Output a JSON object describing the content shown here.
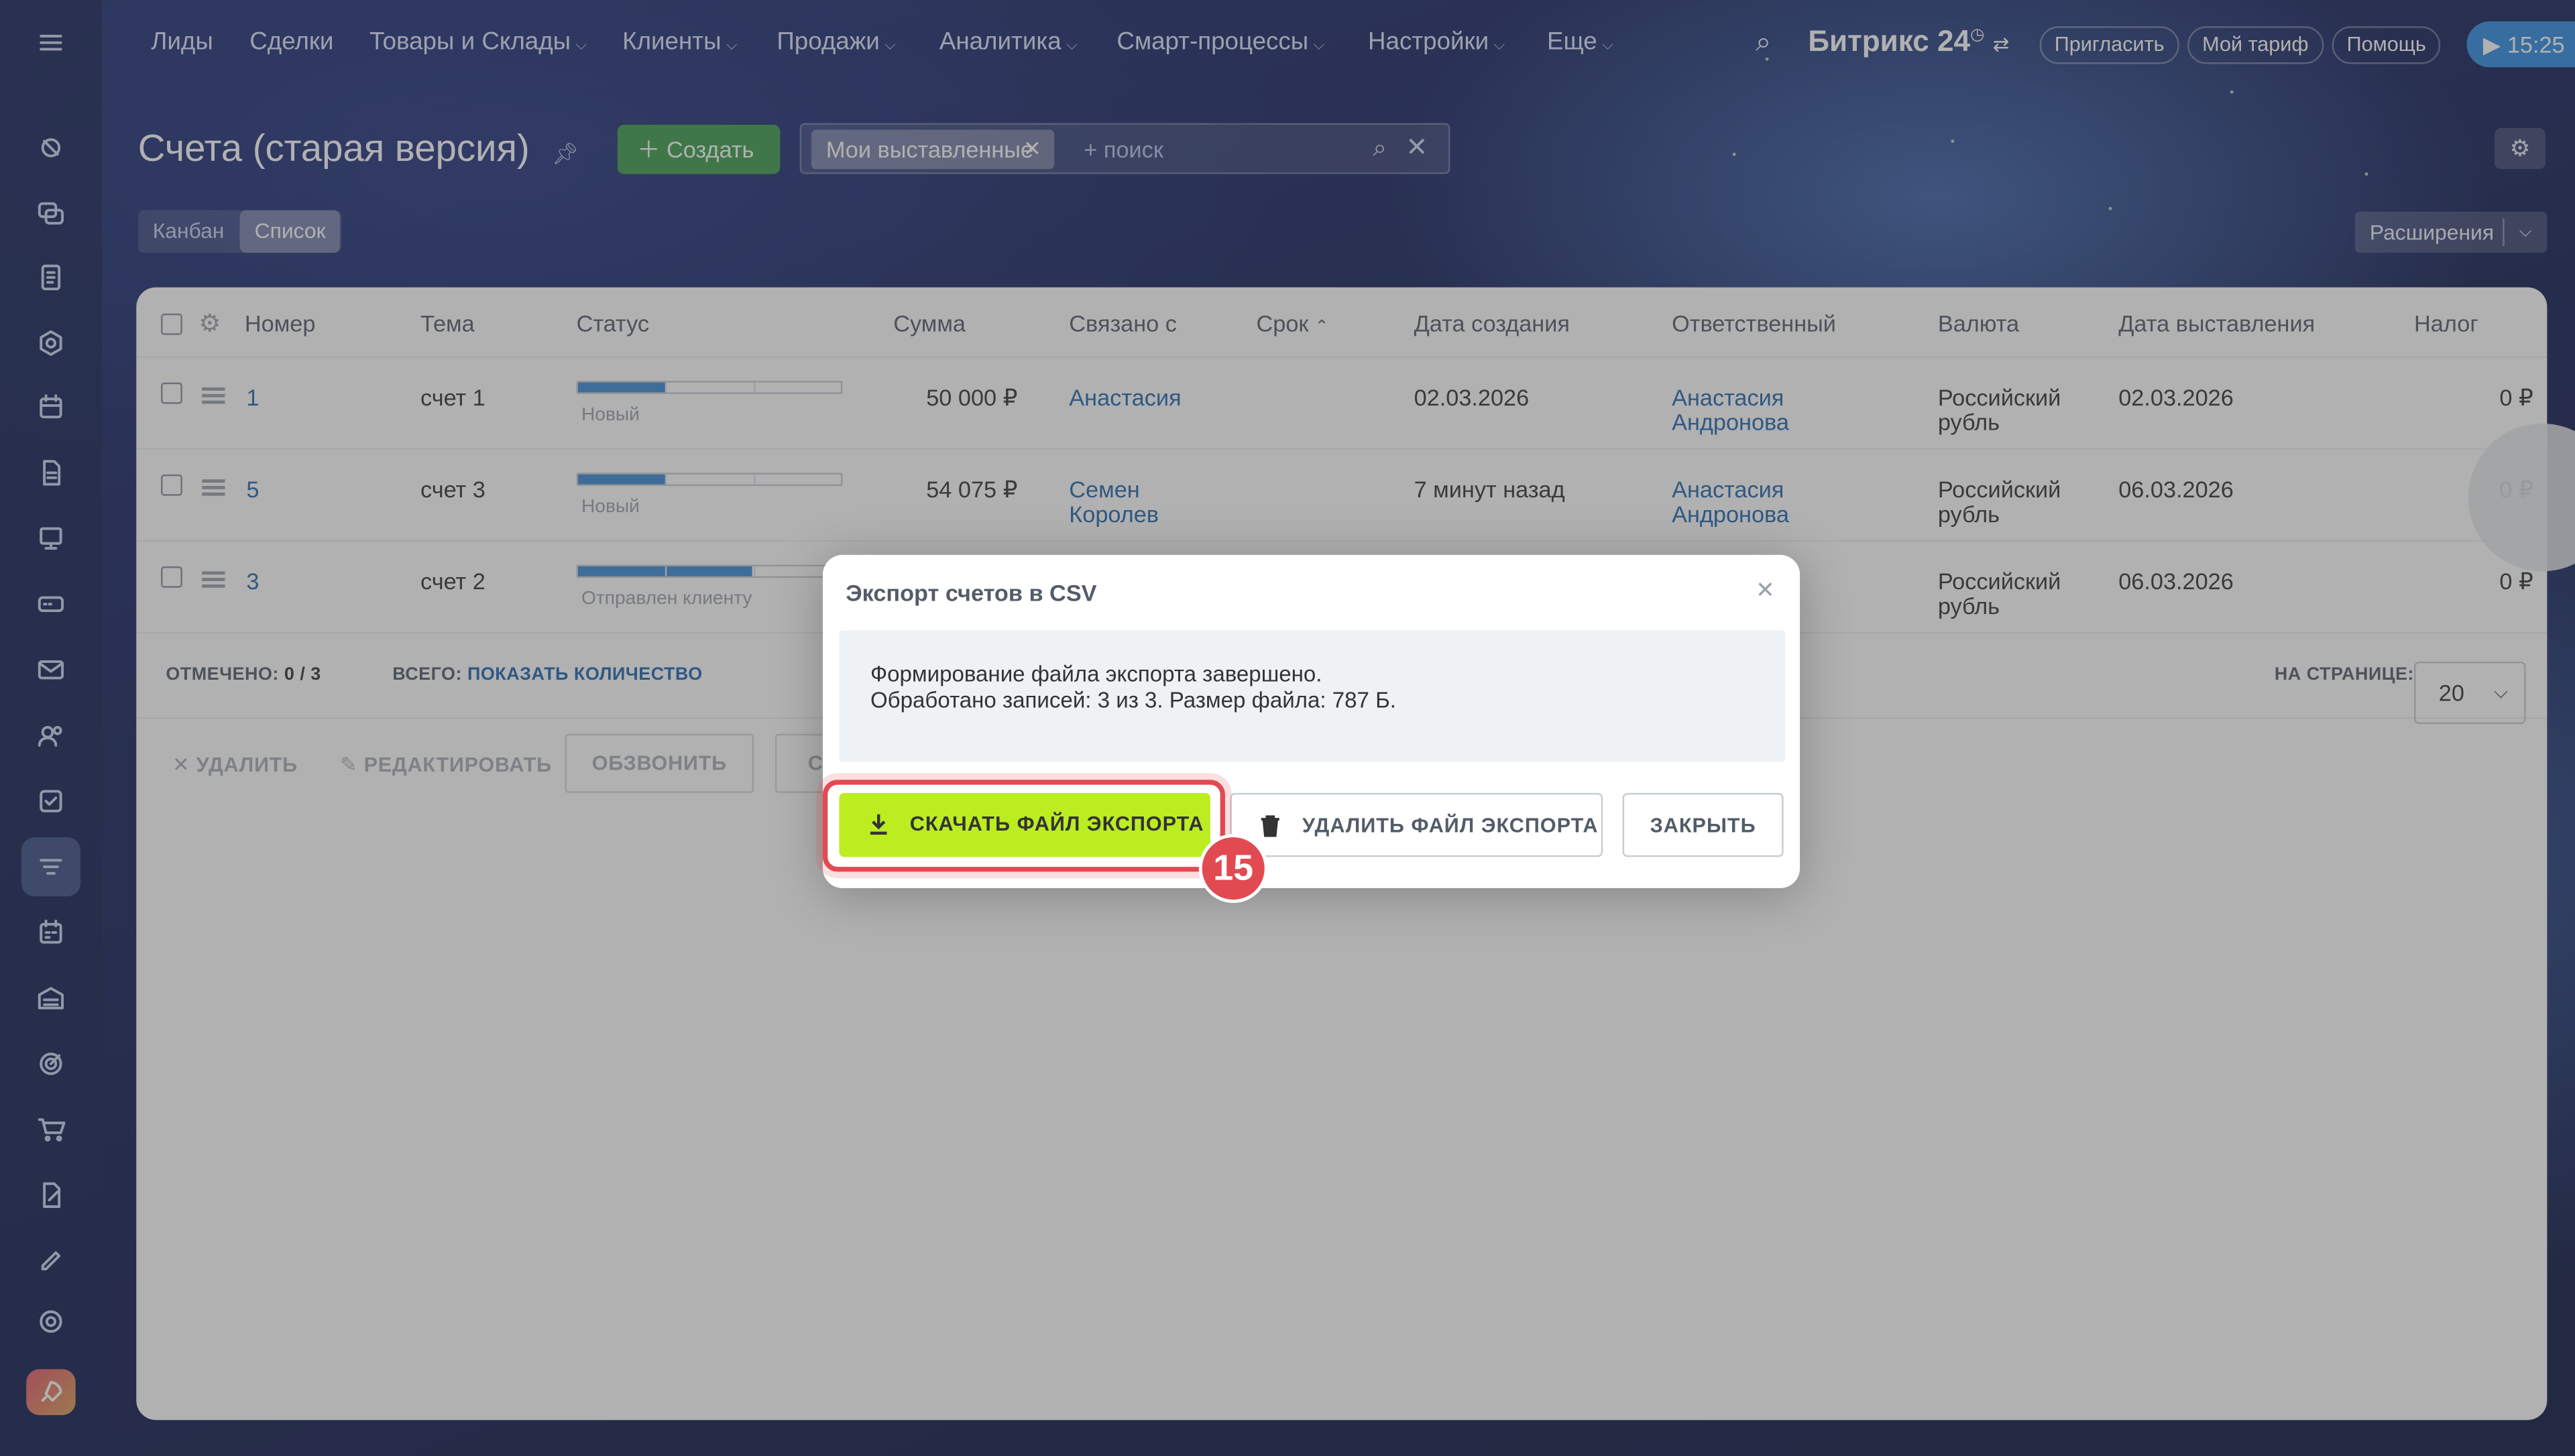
{
  "topnav": {
    "menu": [
      "Лиды",
      "Сделки",
      "Товары и Склады",
      "Клиенты",
      "Продажи",
      "Аналитика",
      "Смарт-процессы",
      "Настройки",
      "Еще"
    ],
    "brand": "Битрикс 24",
    "invite": "Пригласить",
    "tariff": "Мой тариф",
    "help": "Помощь",
    "time": "15:25"
  },
  "page": {
    "title": "Счета (старая версия)",
    "create": "Создать",
    "filter_chip": "Мои выставленные",
    "search_placeholder": "+ поиск",
    "views": [
      "Канбан",
      "Список"
    ],
    "active_view": "Список",
    "extensions": "Расширения"
  },
  "table": {
    "columns": [
      "Номер",
      "Тема",
      "Статус",
      "Сумма",
      "Связано с",
      "Срок",
      "Дата создания",
      "Ответственный",
      "Валюта",
      "Дата выставления",
      "Налог"
    ],
    "rows": [
      {
        "number": "1",
        "topic": "счет 1",
        "status": "Новый",
        "status_progress": 0.33,
        "sum": "50 000 ₽",
        "linked1": "Анастасия",
        "linked2": "",
        "created": "02.03.2026",
        "resp1": "Анастасия",
        "resp2": "Андронова",
        "cur1": "Российский",
        "cur2": "рубль",
        "issued": "02.03.2026",
        "tax": "0 ₽"
      },
      {
        "number": "5",
        "topic": "счет 3",
        "status": "Новый",
        "status_progress": 0.33,
        "sum": "54 075 ₽",
        "linked1": "Семен",
        "linked2": "Королев",
        "created": "7 минут назад",
        "resp1": "Анастасия",
        "resp2": "Андронова",
        "cur1": "Российский",
        "cur2": "рубль",
        "issued": "06.03.2026",
        "tax": "0 ₽"
      },
      {
        "number": "3",
        "topic": "счет 2",
        "status": "Отправлен клиенту",
        "status_progress": 0.66,
        "sum": "",
        "linked1": "",
        "linked2": "",
        "created": "",
        "resp1": "",
        "resp2": "",
        "cur1": "Российский",
        "cur2": "рубль",
        "issued": "06.03.2026",
        "tax": "0 ₽"
      }
    ],
    "selected_label": "ОТМЕЧЕНО:",
    "selected_value": "0 / 3",
    "total_label": "ВСЕГО:",
    "total_link": "ПОКАЗАТЬ КОЛИЧЕСТВО",
    "per_page_label": "НА СТРАНИЦЕ:",
    "per_page": "20"
  },
  "actions": {
    "delete": "УДАЛИТЬ",
    "edit": "РЕДАКТИРОВАТЬ",
    "call": "ОБЗВОНИТЬ",
    "cut": "С"
  },
  "modal": {
    "title": "Экспорт счетов в CSV",
    "line1": "Формирование файла экспорта завершено.",
    "line2": "Обработано записей: 3 из 3. Размер файла: 787 Б.",
    "download": "СКАЧАТЬ ФАЙЛ ЭКСПОРТА",
    "delete_file": "УДАЛИТЬ ФАЙЛ ЭКСПОРТА",
    "close": "ЗАКРЫТЬ",
    "step": "15"
  },
  "colors": {
    "accent_green": "#bbed21",
    "create_green": "#3d9c4c",
    "highlight_red": "#e24a52",
    "link_blue": "#2067b0"
  }
}
